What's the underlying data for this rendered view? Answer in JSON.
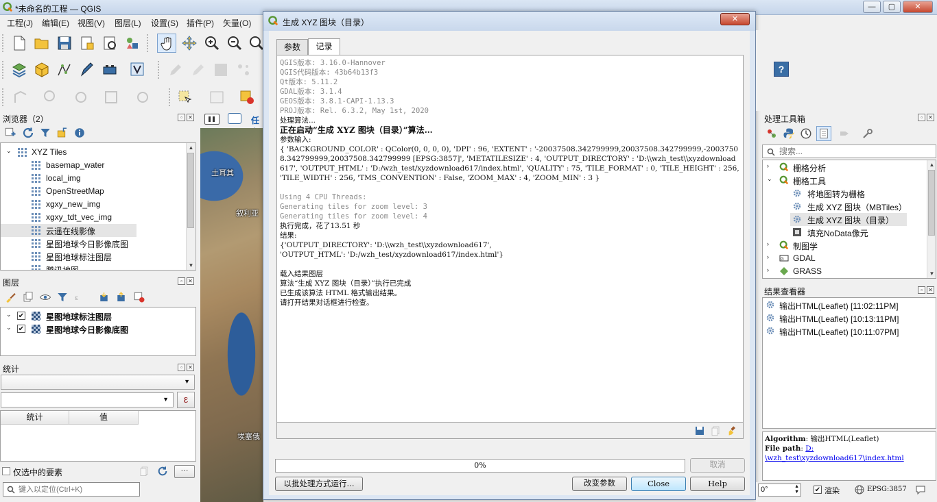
{
  "window": {
    "title": "*未命名的工程 — QGIS",
    "min": "—",
    "max": "▢",
    "close": "✕"
  },
  "menu": [
    "工程(J)",
    "编辑(E)",
    "视图(V)",
    "图层(L)",
    "设置(S)",
    "插件(P)",
    "矢量(O)"
  ],
  "browser": {
    "title": "浏览器（2）",
    "root": "XYZ Tiles",
    "items": [
      "basemap_water",
      "local_img",
      "OpenStreetMap",
      "xgxy_new_img",
      "xgxy_tdt_vec_img",
      "云遥在线影像",
      "星图地球今日影像底图",
      "星图地球标注图层",
      "腾讯地图"
    ]
  },
  "layers": {
    "title": "图层",
    "items": [
      "星图地球标注图层",
      "星图地球今日影像底图"
    ]
  },
  "stats": {
    "title": "统计",
    "col_stat": "统计",
    "col_value": "值",
    "selected_only": "仅选中的要素",
    "expr_icon": "ε",
    "more": "···"
  },
  "locator": {
    "placeholder": "键入以定位(Ctrl+K)"
  },
  "map": {
    "tab_label": "任务",
    "labels": [
      "土耳其",
      "叙利亚",
      "埃塞俄"
    ]
  },
  "dialog": {
    "title": "生成 XYZ 图块（目录）",
    "tabs": [
      "参数",
      "记录"
    ],
    "log": [
      {
        "t": "QGIS版本: 3.16.0-Hannover",
        "c": "gray"
      },
      {
        "t": "QGIS代码版本: 43b64b13f3",
        "c": "gray"
      },
      {
        "t": "Qt版本: 5.11.2",
        "c": "gray"
      },
      {
        "t": "GDAL版本: 3.1.4",
        "c": "gray"
      },
      {
        "t": "GEOS版本: 3.8.1-CAPI-1.13.3",
        "c": "gray"
      },
      {
        "t": "PROJ版本: Rel. 6.3.2, May 1st, 2020",
        "c": "gray"
      },
      {
        "t": "处理算法...",
        "c": ""
      },
      {
        "t": "正在启动“生成 XYZ 图块（目录）”算法…",
        "c": "bold"
      },
      {
        "t": "参数输入:",
        "c": ""
      },
      {
        "t": "{ 'BACKGROUND_COLOR' : QColor(0, 0, 0, 0), 'DPI' : 96, 'EXTENT' : '-20037508.342799999,20037508.342799999,-20037508.342799999,20037508.342799999 [EPSG:3857]', 'METATILESIZE' : 4, 'OUTPUT_DIRECTORY' : 'D:\\\\wzh_test\\\\xyzdownload617', 'OUTPUT_HTML' : 'D:/wzh_test/xyzdownload617/index.html', 'QUALITY' : 75, 'TILE_FORMAT' : 0, 'TILE_HEIGHT' : 256, 'TILE_WIDTH' : 256, 'TMS_CONVENTION' : False, 'ZOOM_MAX' : 4, 'ZOOM_MIN' : 3 }",
        "c": ""
      },
      {
        "t": "",
        "c": ""
      },
      {
        "t": "Using 4 CPU Threads:",
        "c": "gray"
      },
      {
        "t": "Generating tiles for zoom level: 3",
        "c": "gray"
      },
      {
        "t": "Generating tiles for zoom level: 4",
        "c": "gray"
      },
      {
        "t": "执行完成，花了13.51 秒",
        "c": ""
      },
      {
        "t": "结果:",
        "c": ""
      },
      {
        "t": "{'OUTPUT_DIRECTORY': 'D:\\\\wzh_test\\\\xyzdownload617',",
        "c": ""
      },
      {
        "t": "'OUTPUT_HTML': 'D:/wzh_test/xyzdownload617/index.html'}",
        "c": ""
      },
      {
        "t": "",
        "c": ""
      },
      {
        "t": "载入结果图层",
        "c": ""
      },
      {
        "t": "算法“生成 XYZ 图块（目录）”执行已完成",
        "c": ""
      },
      {
        "t": "已生成该算法 HTML 格式输出结果。",
        "c": ""
      },
      {
        "t": "请打开结果对话框进行检查。",
        "c": ""
      }
    ],
    "progress_value": 0,
    "progress_text": "0%",
    "cancel": "取消",
    "batch": "以批处理方式运行...",
    "change_params": "改变参数",
    "close": "Close",
    "help": "Help"
  },
  "toolbox": {
    "title": "处理工具箱",
    "search_placeholder": "搜索...",
    "groups": [
      {
        "label": "栅格分析",
        "expanded": false
      },
      {
        "label": "栅格工具",
        "expanded": true,
        "children": [
          "将地图转为栅格",
          "生成 XYZ 图块（MBTiles）",
          "生成 XYZ 图块（目录）",
          "填充NoData像元"
        ]
      },
      {
        "label": "制图学",
        "expanded": false
      },
      {
        "label": "GDAL",
        "expanded": false
      },
      {
        "label": "GRASS",
        "expanded": false
      }
    ]
  },
  "results": {
    "title": "结果查看器",
    "items": [
      "输出HTML(Leaflet) [11:02:11PM]",
      "输出HTML(Leaflet) [10:13:11PM]",
      "输出HTML(Leaflet) [10:11:07PM]"
    ],
    "detail": {
      "algorithm_label": "Algorithm",
      "algorithm_value": ": 输出HTML(Leaflet)",
      "filepath_label": "File path",
      "filepath_sep": ": ",
      "filepath_link1": "D:",
      "filepath_link2": "\\wzh_test\\xyzdownload617\\index.html"
    }
  },
  "status": {
    "rotation": "0°",
    "render_label": "渲染",
    "crs": "EPSG:3857"
  },
  "colors": {
    "accent": "#3c7fb1",
    "qgis_green": "#6aa84f",
    "link": "#0000ee"
  }
}
